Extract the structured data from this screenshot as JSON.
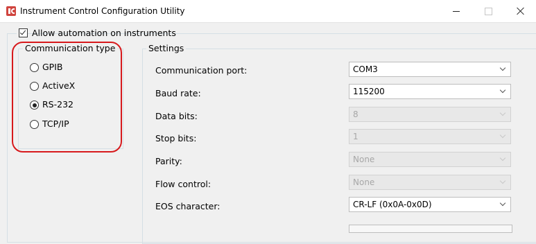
{
  "window": {
    "title": "Instrument Control Configuration Utility"
  },
  "automation": {
    "label": "Allow automation on instruments",
    "checked": true
  },
  "communication_type": {
    "title": "Communication type",
    "options": [
      {
        "label": "GPIB",
        "selected": false
      },
      {
        "label": "ActiveX",
        "selected": false
      },
      {
        "label": "RS-232",
        "selected": true
      },
      {
        "label": "TCP/IP",
        "selected": false
      }
    ]
  },
  "settings": {
    "title": "Settings",
    "fields": [
      {
        "label": "Communication port:",
        "value": "COM3",
        "enabled": true
      },
      {
        "label": "Baud rate:",
        "value": "115200",
        "enabled": true
      },
      {
        "label": "Data bits:",
        "value": "8",
        "enabled": false
      },
      {
        "label": "Stop bits:",
        "value": "1",
        "enabled": false
      },
      {
        "label": "Parity:",
        "value": "None",
        "enabled": false
      },
      {
        "label": "Flow control:",
        "value": "None",
        "enabled": false
      },
      {
        "label": "EOS character:",
        "value": "CR-LF (0x0A-0x0D)",
        "enabled": true
      }
    ]
  },
  "colors": {
    "highlight": "#d7191c",
    "app_icon": "#d0453f"
  },
  "icons": [
    "app-icon",
    "minimize-icon",
    "maximize-icon",
    "close-icon",
    "chevron-down-icon"
  ]
}
